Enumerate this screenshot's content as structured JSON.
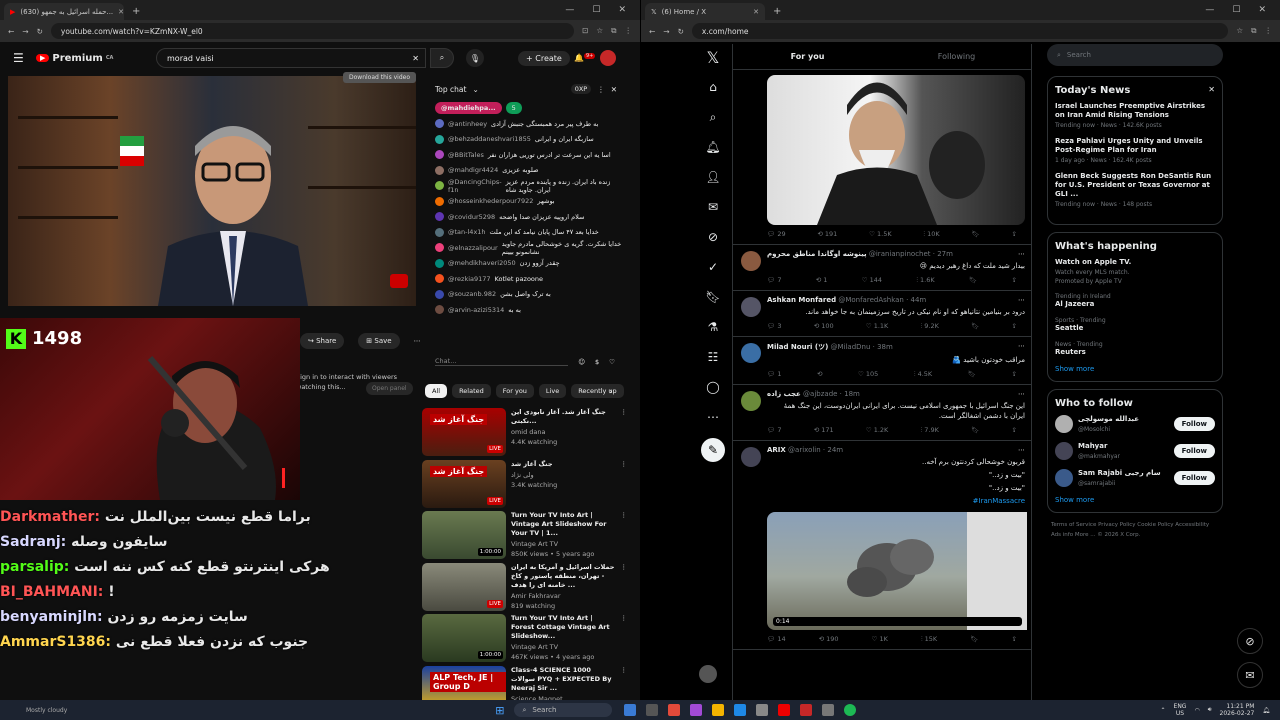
{
  "left_browser": {
    "tab_title": "(630) حمله اسرائیل به جمهو...",
    "url": "youtube.com/watch?v=KZmNX-W_el0"
  },
  "right_browser": {
    "tab_title": "(6) Home / X",
    "url": "x.com/home"
  },
  "youtube": {
    "logo": "Premium",
    "logo_sup": "CA",
    "search_value": "morad vaisi",
    "create_label": "Create",
    "notif_count": "9+",
    "video_overlay_text": "Download this video",
    "actions": {
      "share": "Share",
      "save": "Save"
    },
    "chat": {
      "header": "Top chat",
      "points": "0XP",
      "pinned_user": "@mahdiehpa...",
      "pinned_count": "5",
      "placeholder": "Chat...",
      "messages": [
        {
          "user": "@antinheey",
          "text": "به طرف پیر مرد همبستگی جنبش آزادی"
        },
        {
          "user": "@behzaddaneshvari1855",
          "text": "سازبگه ایران و ایرانی"
        },
        {
          "user": "@BBitTales",
          "text": "اسا یه این سرعت تر ادرس توریی هزاران نفر"
        },
        {
          "user": "@mahdigr4424",
          "text": "صلوبه عزیزی"
        },
        {
          "user": "@DancingChips-f1n",
          "text": "زنده باد ایران. زنده و پاینده مردم عزیز ایران. جاوید شاه"
        },
        {
          "user": "@hosseinkhederpour7922",
          "text": "بوشهر"
        },
        {
          "user": "@covidur5298",
          "text": "سلام اروپیه عزیزان صدا واضحه"
        },
        {
          "user": "@tan-l4x1h",
          "text": "خدایا بعد ۴۷ سال پایان نیامد که این ملت"
        },
        {
          "user": "@elnazzalipour",
          "text": "خدایا شکرت. گریه ی خوشحالی مادرم جاوید نشانمونو بیینم"
        },
        {
          "user": "@mehdikhaveri2050",
          "text": "چقدر آزوو زدن"
        },
        {
          "user": "@rezkia9177",
          "text": "Kotlet pazoone"
        },
        {
          "user": "@souzanb.982",
          "text": "به ترک واصل بشن"
        },
        {
          "user": "@arvin-azizi5314",
          "text": "به به"
        }
      ]
    },
    "recommended_chips": [
      "All",
      "Related",
      "For you",
      "Live",
      "Recently up"
    ],
    "interact_text": "Sign in to interact with viewers watching this...",
    "open_panel": "Open panel",
    "recommended": [
      {
        "title": "جنگ آغاز شد. آغاز نابودی این نکبتی...",
        "thumb_text": "جنگ آغاز شد",
        "channel": "omid dana",
        "meta": "4.4K watching",
        "badge": "LIVE"
      },
      {
        "title": "جنگ آغاز شد",
        "thumb_text": "جنگ آغاز شد",
        "channel": "ولی نژاد",
        "meta": "3.4K watching",
        "badge": "LIVE"
      },
      {
        "title": "Turn Your TV Into Art | Vintage Art Slideshow For Your TV | 1...",
        "channel": "Vintage Art TV",
        "meta": "850K views • 5 years ago",
        "badge": "1:00:00"
      },
      {
        "title": "حملات اسرائیل و آمریکا به ایران - تهران، منطقه پاستور و کاخ خامنه ای را هدف ...",
        "channel": "Amir Fakhravar",
        "meta": "819 watching",
        "badge": "LIVE"
      },
      {
        "title": "Turn Your TV Into Art | Forest Cottage Vintage Art Slideshow...",
        "channel": "Vintage Art TV",
        "meta": "467K views • 4 years ago",
        "badge": "1:00:00"
      },
      {
        "title": "Class-4 SCIENCE 1000 سوالات PYQ + EXPECTED By Neeraj Sir ...",
        "thumb_text": "ALP Tech, JE | Group D",
        "channel": "Science Magnet",
        "meta": "",
        "badge": ""
      }
    ]
  },
  "stream_overlay": {
    "viewer_count": "1498",
    "chat": [
      {
        "user": "Darkmather:",
        "text": "براما قطع نیست بین‌الملل نت",
        "color": "#ff5555"
      },
      {
        "user": "Sadranj:",
        "text": "سایفون وصله",
        "color": "#d8d8ff"
      },
      {
        "user": "parsalip:",
        "text": "هرکی اینترنتو قطع کنه کس ننه",
        "color": "#53fc18",
        "extra": "است"
      },
      {
        "user": "BI_BAHMANI:",
        "text": "!",
        "color": "#ff5555"
      },
      {
        "user": "benyaminjln:",
        "text": "سایت زمزمه رو زدن",
        "color": "#d8d8ff"
      },
      {
        "user": "AmmarS1386:",
        "text": "جنوب که نزدن فعلا قطع نی",
        "color": "#ffd54f"
      }
    ]
  },
  "x": {
    "tabs": [
      "For you",
      "Following"
    ],
    "search_placeholder": "Search",
    "posts": [
      {
        "name": "",
        "handle": "",
        "time": "",
        "text": "",
        "counts": [
          "29",
          "191",
          "1.5K",
          "10K"
        ],
        "image": "portrait"
      },
      {
        "name": "پینوشه اوگاندا مناطق محروم",
        "handle": "@iranianpinochet · 27m",
        "text": "بیدار شید ملت که داغ رهبر دیدیم 😢",
        "counts": [
          "7",
          "1",
          "144",
          "1.6K"
        ]
      },
      {
        "name": "Ashkan Monfared",
        "handle": "@MonfaredAshkan · 44m",
        "text": "درود بر بنیامین نتانیاهو که او نام نیکی در تاریخ سرزمینمان به جا خواهد ماند.",
        "counts": [
          "3",
          "100",
          "1.1K",
          "9.2K"
        ]
      },
      {
        "name": "Milad Nouri (ツ)",
        "handle": "@MiladDnu · 38m",
        "text": "مراقب خودتون باشید 🫂",
        "counts": [
          "1",
          "",
          "105",
          "4.5K"
        ]
      },
      {
        "name": "عجب زاده",
        "handle": "@ajbzade · 18m",
        "text": "این جنگ اسرائیل با جمهوری اسلامی نیست. برای ایرانی ایران‌دوست، این جنگ همهٔ ایران با دشمن اشغالگر است.",
        "counts": [
          "7",
          "171",
          "1.2K",
          "7.9K"
        ]
      },
      {
        "name": "ARIX",
        "handle": "@arixolin · 24m",
        "text": "قربون خوشحالی کردنتون برم آخه..\n\"بیت و زد..\"\n\"بیت و زد..\"",
        "hashtag": "#IranMassacre",
        "counts": [
          "14",
          "190",
          "1K",
          "15K"
        ],
        "video_time": "0:14",
        "image": "smoke"
      }
    ],
    "news": {
      "title": "Today's News",
      "items": [
        {
          "title": "Israel Launches Preemptive Airstrikes on Iran Amid Rising Tensions",
          "meta": "Trending now · News · 142.6K posts"
        },
        {
          "title": "Reza Pahlavi Urges Unity and Unveils Post-Regime Plan for Iran",
          "meta": "1 day ago · News · 162.4K posts"
        },
        {
          "title": "Glenn Beck Suggests Ron DeSantis Run for U.S. President or Texas Governor at GLI ...",
          "meta": "Trending now · News · 148 posts"
        }
      ]
    },
    "happening": {
      "title": "What's happening",
      "items": [
        {
          "title": "Watch on Apple TV.",
          "meta": "Watch every MLS match.",
          "sub": "Promoted by Apple TV"
        },
        {
          "pre": "Trending in Ireland",
          "title": "Al Jazeera"
        },
        {
          "pre": "Sports · Trending",
          "title": "Seattle"
        },
        {
          "pre": "News · Trending",
          "title": "Reuters"
        }
      ],
      "show_more": "Show more"
    },
    "who_to_follow": {
      "title": "Who to follow",
      "users": [
        {
          "name": "عبدالله موسولچی",
          "handle": "@Mosolchi"
        },
        {
          "name": "Mahyar",
          "handle": "@makmahyar"
        },
        {
          "name": "Sam Rajabi سام رجبی",
          "handle": "@samrajabii"
        }
      ],
      "button": "Follow",
      "show_more": "Show more"
    },
    "footer": "Terms of Service   Privacy Policy   Cookie Policy   Accessibility   Ads info   More ...   © 2026 X Corp."
  },
  "taskbar": {
    "search": "Search",
    "weather": "Mostly cloudy",
    "lang": "ENG",
    "region": "US",
    "time": "11:21 PM",
    "date": "2026-02-27"
  }
}
